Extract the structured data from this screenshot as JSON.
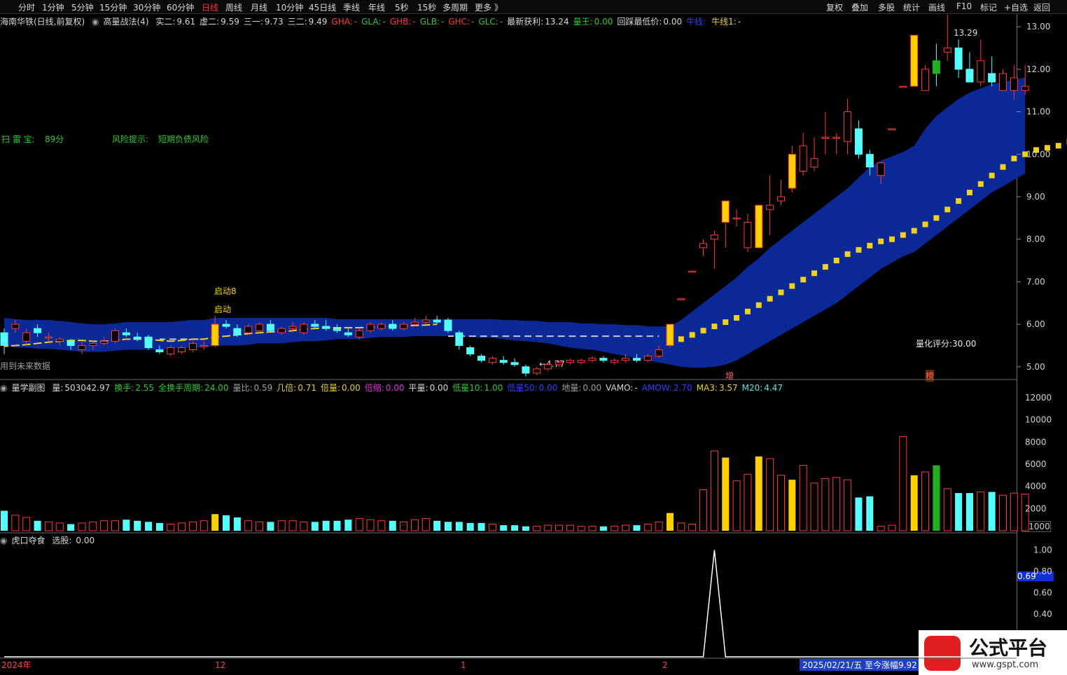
{
  "toolbar": {
    "tabs": [
      "分时",
      "1分钟",
      "5分钟",
      "15分钟",
      "30分钟",
      "60分钟",
      "日线",
      "周线",
      "月线",
      "10分钟",
      "45日线",
      "季线",
      "年线",
      "5秒",
      "15秒",
      "多周期",
      "更多 》"
    ],
    "active_index": 6,
    "right_buttons": [
      "复权",
      "叠加",
      "多股",
      "统计",
      "画线",
      "F10",
      "标记",
      "+自选",
      "返回"
    ]
  },
  "main_header": {
    "stock": "海南华铁(日线,前复权)",
    "indicator": "高量战法(4)",
    "items": [
      {
        "label": "实二:",
        "value": "9.61",
        "color": "w"
      },
      {
        "label": "虚二:",
        "value": "9.59",
        "color": "w"
      },
      {
        "label": "三一:",
        "value": "9.73",
        "color": "w"
      },
      {
        "label": "三二:",
        "value": "9.49",
        "color": "w"
      },
      {
        "label": "GHA:",
        "value": "-",
        "color": "r"
      },
      {
        "label": "GLA:",
        "value": "-",
        "color": "g"
      },
      {
        "label": "GHB:",
        "value": "-",
        "color": "r"
      },
      {
        "label": "GLB:",
        "value": "-",
        "color": "g"
      },
      {
        "label": "GHC:",
        "value": "-",
        "color": "r"
      },
      {
        "label": "GLC:",
        "value": "-",
        "color": "g"
      },
      {
        "label": "最新获利:",
        "value": "13.24",
        "color": "w"
      },
      {
        "label": "量王:",
        "value": "0.00",
        "color": "g"
      },
      {
        "label": "回踩最低价:",
        "value": "0.00",
        "color": "w"
      },
      {
        "label": "牛线:",
        "value": "",
        "color": "b"
      },
      {
        "label": "牛线1:",
        "value": "-",
        "color": "y"
      }
    ]
  },
  "main_notes": {
    "scan_label": "扫 雷 宝:",
    "scan_value": "89分",
    "risk_label": "风险提示:",
    "risk_value": "短期负债风险",
    "start8": "启动8",
    "start": "启动",
    "low_label": "←4.77",
    "high_label": "13.29",
    "score": "量化评分:30.00",
    "future_data": "用到未来数据",
    "tag_zeng": "增",
    "tag_bang": "榜",
    "watermark": "www.gspt.com"
  },
  "vol_header": {
    "name": "量学副图",
    "items": [
      {
        "label": "量:",
        "value": "503042.97",
        "color": "w"
      },
      {
        "label": "换手:",
        "value": "2.55",
        "color": "g"
      },
      {
        "label": "全换手周期:",
        "value": "24.00",
        "color": "g"
      },
      {
        "label": "量比:",
        "value": "0.59",
        "color": "gr"
      },
      {
        "label": "几倍:",
        "value": "0.71",
        "color": "y"
      },
      {
        "label": "倍量:",
        "value": "0.00",
        "color": "y"
      },
      {
        "label": "倍缩:",
        "value": "0.00",
        "color": "m"
      },
      {
        "label": "平量:",
        "value": "0.00",
        "color": "w"
      },
      {
        "label": "低量10:",
        "value": "1.00",
        "color": "g"
      },
      {
        "label": "低量50:",
        "value": "0.00",
        "color": "b"
      },
      {
        "label": "地量:",
        "value": "0.00",
        "color": "gr"
      },
      {
        "label": "VAMO:",
        "value": "-",
        "color": "w"
      },
      {
        "label": "AMOW:",
        "value": "2.70",
        "color": "b"
      },
      {
        "label": "MA3:",
        "value": "3.57",
        "color": "y"
      },
      {
        "label": "M20:",
        "value": "4.47",
        "color": "c"
      }
    ],
    "unit": "X1000"
  },
  "sub_header": {
    "name": "虎口夺食",
    "label": "选股:",
    "value": "0.00",
    "current": "0.69"
  },
  "x_labels": [
    "2024年",
    "12",
    "1",
    "2"
  ],
  "status": {
    "date": "2025/02/21/五",
    "gain": "至今涨幅9.92"
  },
  "logo": {
    "text": "公式平台",
    "url": "www.gspt.com"
  },
  "chart_data": [
    {
      "type": "candlestick",
      "title": "海南华铁(日线,前复权)",
      "ylim": [
        4.7,
        13.3
      ],
      "yticks": [
        5.0,
        6.0,
        7.0,
        8.0,
        9.0,
        10.0,
        11.0,
        12.0,
        13.0
      ],
      "ohlc": [
        [
          5.8,
          5.9,
          5.3,
          5.5
        ],
        [
          5.9,
          6.1,
          5.8,
          6.0
        ],
        [
          5.6,
          5.9,
          5.5,
          5.8
        ],
        [
          5.9,
          6.0,
          5.7,
          5.8
        ],
        [
          5.7,
          5.8,
          5.6,
          5.7
        ],
        [
          5.6,
          5.7,
          5.5,
          5.65
        ],
        [
          5.6,
          5.65,
          5.4,
          5.5
        ],
        [
          5.4,
          5.6,
          5.3,
          5.5
        ],
        [
          5.5,
          5.6,
          5.4,
          5.55
        ],
        [
          5.55,
          5.7,
          5.5,
          5.6
        ],
        [
          5.6,
          5.9,
          5.55,
          5.85
        ],
        [
          5.8,
          5.9,
          5.7,
          5.75
        ],
        [
          5.7,
          5.8,
          5.6,
          5.65
        ],
        [
          5.7,
          5.75,
          5.4,
          5.45
        ],
        [
          5.4,
          5.5,
          5.3,
          5.35
        ],
        [
          5.3,
          5.5,
          5.25,
          5.45
        ],
        [
          5.35,
          5.5,
          5.3,
          5.45
        ],
        [
          5.4,
          5.6,
          5.35,
          5.55
        ],
        [
          5.5,
          5.6,
          5.4,
          5.5
        ],
        [
          5.5,
          6.2,
          5.45,
          6.0
        ],
        [
          6.0,
          6.1,
          5.9,
          5.95
        ],
        [
          5.9,
          6.0,
          5.7,
          5.75
        ],
        [
          5.8,
          6.0,
          5.75,
          5.95
        ],
        [
          5.85,
          6.05,
          5.8,
          6.0
        ],
        [
          6.0,
          6.1,
          5.8,
          5.85
        ],
        [
          5.8,
          5.95,
          5.75,
          5.9
        ],
        [
          5.9,
          6.05,
          5.8,
          5.95
        ],
        [
          5.8,
          6.05,
          5.75,
          6.0
        ],
        [
          6.0,
          6.1,
          5.9,
          5.95
        ],
        [
          5.95,
          6.1,
          5.85,
          5.9
        ],
        [
          5.9,
          6.0,
          5.8,
          5.85
        ],
        [
          5.8,
          5.9,
          5.7,
          5.75
        ],
        [
          5.7,
          5.9,
          5.65,
          5.85
        ],
        [
          5.85,
          6.05,
          5.8,
          6.0
        ],
        [
          5.9,
          6.05,
          5.85,
          6.0
        ],
        [
          6.0,
          6.1,
          5.85,
          5.9
        ],
        [
          5.9,
          6.05,
          5.85,
          6.0
        ],
        [
          6.0,
          6.15,
          5.95,
          6.05
        ],
        [
          6.05,
          6.2,
          6.0,
          6.1
        ],
        [
          6.1,
          6.2,
          6.0,
          6.05
        ],
        [
          6.1,
          6.15,
          5.8,
          5.85
        ],
        [
          5.8,
          5.85,
          5.4,
          5.5
        ],
        [
          5.45,
          5.5,
          5.25,
          5.3
        ],
        [
          5.25,
          5.3,
          5.1,
          5.15
        ],
        [
          5.1,
          5.25,
          5.05,
          5.2
        ],
        [
          5.15,
          5.25,
          5.05,
          5.1
        ],
        [
          5.1,
          5.2,
          5.0,
          5.05
        ],
        [
          5.0,
          5.05,
          4.77,
          4.85
        ],
        [
          4.85,
          5.0,
          4.8,
          4.95
        ],
        [
          4.95,
          5.1,
          4.9,
          5.05
        ],
        [
          5.05,
          5.15,
          5.0,
          5.1
        ],
        [
          5.1,
          5.2,
          5.05,
          5.15
        ],
        [
          5.1,
          5.2,
          5.05,
          5.15
        ],
        [
          5.15,
          5.25,
          5.1,
          5.2
        ],
        [
          5.2,
          5.25,
          5.1,
          5.15
        ],
        [
          5.1,
          5.2,
          5.05,
          5.15
        ],
        [
          5.15,
          5.3,
          5.1,
          5.2
        ],
        [
          5.2,
          5.3,
          5.1,
          5.15
        ],
        [
          5.15,
          5.3,
          5.1,
          5.25
        ],
        [
          5.25,
          5.5,
          5.2,
          5.4
        ],
        [
          5.5,
          6.0,
          5.45,
          6.0
        ],
        [
          6.6,
          6.6,
          6.6,
          6.6
        ],
        [
          7.25,
          7.25,
          7.25,
          7.25
        ],
        [
          7.8,
          8.0,
          7.6,
          7.9
        ],
        [
          8.0,
          8.2,
          7.3,
          8.1
        ],
        [
          8.4,
          8.9,
          7.8,
          8.9
        ],
        [
          8.5,
          8.7,
          8.3,
          8.5
        ],
        [
          7.8,
          8.6,
          7.7,
          8.4
        ],
        [
          7.8,
          8.8,
          7.8,
          8.8
        ],
        [
          8.7,
          9.5,
          8.1,
          8.8
        ],
        [
          8.9,
          9.4,
          8.8,
          9.0
        ],
        [
          9.2,
          10.2,
          9.1,
          10.0
        ],
        [
          9.6,
          10.5,
          9.5,
          10.2
        ],
        [
          9.7,
          10.4,
          9.6,
          9.9
        ],
        [
          10.4,
          11.0,
          10.0,
          10.4
        ],
        [
          10.4,
          10.5,
          10.0,
          10.4
        ],
        [
          10.3,
          11.3,
          10.0,
          11.0
        ],
        [
          10.6,
          10.8,
          9.9,
          10.0
        ],
        [
          10.0,
          10.1,
          9.5,
          9.7
        ],
        [
          9.5,
          9.8,
          9.3,
          9.8
        ],
        [
          10.6,
          10.6,
          10.6,
          10.6
        ],
        [
          11.6,
          11.6,
          11.6,
          11.6
        ],
        [
          11.6,
          12.8,
          11.6,
          12.8
        ],
        [
          11.5,
          12.1,
          11.5,
          12.0
        ],
        [
          12.2,
          12.6,
          11.6,
          11.9
        ],
        [
          12.4,
          13.29,
          12.2,
          12.5
        ],
        [
          12.5,
          12.7,
          11.8,
          12.0
        ],
        [
          12.0,
          12.4,
          11.7,
          11.7
        ],
        [
          11.7,
          12.7,
          11.6,
          12.2
        ],
        [
          11.9,
          12.3,
          11.6,
          11.7
        ],
        [
          11.5,
          12.0,
          11.5,
          11.9
        ],
        [
          11.5,
          12.1,
          11.3,
          11.8
        ],
        [
          11.5,
          12.1,
          11.4,
          11.6
        ]
      ],
      "band_upper": [
        6.15,
        6.12,
        6.1,
        6.1,
        6.1,
        6.08,
        6.05,
        6.02,
        6.0,
        6.0,
        6.02,
        6.05,
        6.05,
        6.05,
        6.05,
        6.05,
        6.08,
        6.1,
        6.1,
        6.15,
        6.15,
        6.15,
        6.15,
        6.15,
        6.15,
        6.15,
        6.15,
        6.15,
        6.15,
        6.15,
        6.12,
        6.12,
        6.12,
        6.12,
        6.12,
        6.12,
        6.12,
        6.12,
        6.12,
        6.12,
        6.12,
        6.12,
        6.12,
        6.12,
        6.12,
        6.1,
        6.1,
        6.08,
        6.08,
        6.05,
        6.05,
        6.05,
        6.02,
        6.02,
        6.0,
        6.0,
        5.98,
        5.98,
        5.95,
        5.95,
        5.95,
        6.1,
        6.3,
        6.5,
        6.7,
        6.9,
        7.1,
        7.35,
        7.55,
        7.8,
        8.0,
        8.2,
        8.4,
        8.6,
        8.8,
        9.0,
        9.2,
        9.45,
        9.7,
        9.85,
        9.95,
        10.05,
        10.2,
        10.6,
        10.9,
        11.1,
        11.3,
        11.45,
        11.55,
        11.65,
        11.7,
        11.75,
        11.8
      ],
      "band_lower": [
        5.5,
        5.45,
        5.45,
        5.42,
        5.42,
        5.4,
        5.38,
        5.35,
        5.35,
        5.35,
        5.38,
        5.4,
        5.4,
        5.4,
        5.4,
        5.42,
        5.45,
        5.45,
        5.45,
        5.5,
        5.5,
        5.5,
        5.52,
        5.55,
        5.55,
        5.55,
        5.58,
        5.6,
        5.6,
        5.62,
        5.65,
        5.65,
        5.65,
        5.68,
        5.7,
        5.7,
        5.7,
        5.72,
        5.72,
        5.72,
        5.72,
        5.7,
        5.7,
        5.68,
        5.68,
        5.65,
        5.62,
        5.6,
        5.58,
        5.55,
        5.5,
        5.45,
        5.42,
        5.4,
        5.35,
        5.3,
        5.25,
        5.2,
        5.15,
        5.1,
        5.05,
        5.0,
        4.98,
        4.98,
        5.0,
        5.05,
        5.15,
        5.3,
        5.45,
        5.6,
        5.75,
        5.9,
        6.05,
        6.2,
        6.35,
        6.5,
        6.7,
        6.9,
        7.1,
        7.3,
        7.45,
        7.6,
        7.7,
        7.9,
        8.1,
        8.3,
        8.5,
        8.7,
        8.9,
        9.1,
        9.25,
        9.4,
        9.55
      ],
      "ma_yellow": [
        5.48,
        5.5,
        5.52,
        5.55,
        5.58,
        5.6,
        5.62,
        5.62,
        5.6,
        5.6,
        5.62,
        5.65,
        5.65,
        5.65,
        5.62,
        5.6,
        5.62,
        5.65,
        5.65,
        5.7,
        5.72,
        5.75,
        5.78,
        5.8,
        5.82,
        5.82,
        5.85,
        5.88,
        5.9,
        5.92,
        5.92,
        5.92,
        5.92,
        5.93,
        5.95,
        5.95,
        5.96,
        5.97,
        5.98,
        6.0,
        null,
        null,
        null,
        null,
        null,
        null,
        null,
        null,
        null,
        null,
        null,
        null,
        null,
        null,
        null,
        null,
        null,
        null,
        null,
        null,
        5.6,
        5.65,
        5.75,
        5.85,
        5.95,
        6.05,
        6.15,
        6.3,
        6.45,
        6.6,
        6.75,
        6.9,
        7.05,
        7.2,
        7.35,
        7.5,
        7.65,
        7.75,
        7.85,
        7.95,
        8.0,
        8.1,
        8.2,
        8.35,
        8.5,
        8.7,
        8.9,
        9.1,
        9.3,
        9.5,
        9.7,
        9.9,
        10.0,
        10.1,
        10.15,
        10.2,
        10.3,
        10.4
      ],
      "ma_dash": [
        null,
        null,
        null,
        null,
        null,
        null,
        null,
        null,
        null,
        null,
        null,
        null,
        null,
        null,
        5.65,
        5.65,
        5.65,
        5.65,
        5.65,
        null,
        null,
        null,
        null,
        null,
        null,
        null,
        null,
        null,
        null,
        null,
        null,
        null,
        null,
        null,
        null,
        null,
        null,
        null,
        null,
        null,
        5.72,
        5.72,
        5.72,
        5.72,
        5.72,
        5.72,
        5.72,
        5.72,
        5.72,
        5.72,
        5.72,
        5.72,
        5.72,
        5.72,
        5.72,
        5.72,
        5.72,
        5.72,
        5.72,
        5.72
      ]
    },
    {
      "type": "bar",
      "title": "量学副图",
      "ylim": [
        0,
        12500
      ],
      "yticks": [
        2000,
        4000,
        6000,
        8000,
        10000,
        12000
      ],
      "values": [
        1800,
        1400,
        1200,
        900,
        800,
        700,
        600,
        700,
        800,
        900,
        900,
        1000,
        900,
        800,
        700,
        600,
        700,
        800,
        900,
        1500,
        1400,
        1200,
        900,
        800,
        800,
        900,
        900,
        800,
        800,
        900,
        900,
        1000,
        1100,
        1000,
        900,
        900,
        800,
        1000,
        1100,
        900,
        800,
        800,
        700,
        700,
        600,
        500,
        500,
        400,
        400,
        500,
        500,
        500,
        400,
        400,
        400,
        400,
        500,
        500,
        600,
        800,
        1600,
        700,
        600,
        3700,
        7200,
        6600,
        4500,
        5100,
        6700,
        6500,
        5000,
        4600,
        5900,
        4300,
        4700,
        4800,
        4600,
        3000,
        3100,
        400,
        500,
        8500,
        5000,
        5300,
        5900,
        3800,
        3400,
        3400,
        3500,
        3500,
        3200,
        3400,
        3300
      ]
    },
    {
      "type": "line",
      "title": "虎口夺食",
      "ylim": [
        0,
        1.05
      ],
      "yticks": [
        0.4,
        0.6,
        0.8,
        1.0
      ],
      "values": [
        0,
        0,
        0,
        0,
        0,
        0,
        0,
        0,
        0,
        0,
        0,
        0,
        0,
        0,
        0,
        0,
        0,
        0,
        0,
        0,
        0,
        0,
        0,
        0,
        0,
        0,
        0,
        0,
        0,
        0,
        0,
        0,
        0,
        0,
        0,
        0,
        0,
        0,
        0,
        0,
        0,
        0,
        0,
        0,
        0,
        0,
        0,
        0,
        0,
        0,
        0,
        0,
        0,
        0,
        0,
        0,
        0,
        0,
        0,
        0,
        0,
        0,
        0,
        0,
        1,
        0,
        0,
        0,
        0,
        0,
        0,
        0,
        0,
        0,
        0,
        0,
        0,
        0,
        0,
        0,
        0,
        0,
        0,
        0,
        0,
        0,
        0,
        0,
        0,
        0,
        0,
        0,
        0
      ]
    }
  ]
}
